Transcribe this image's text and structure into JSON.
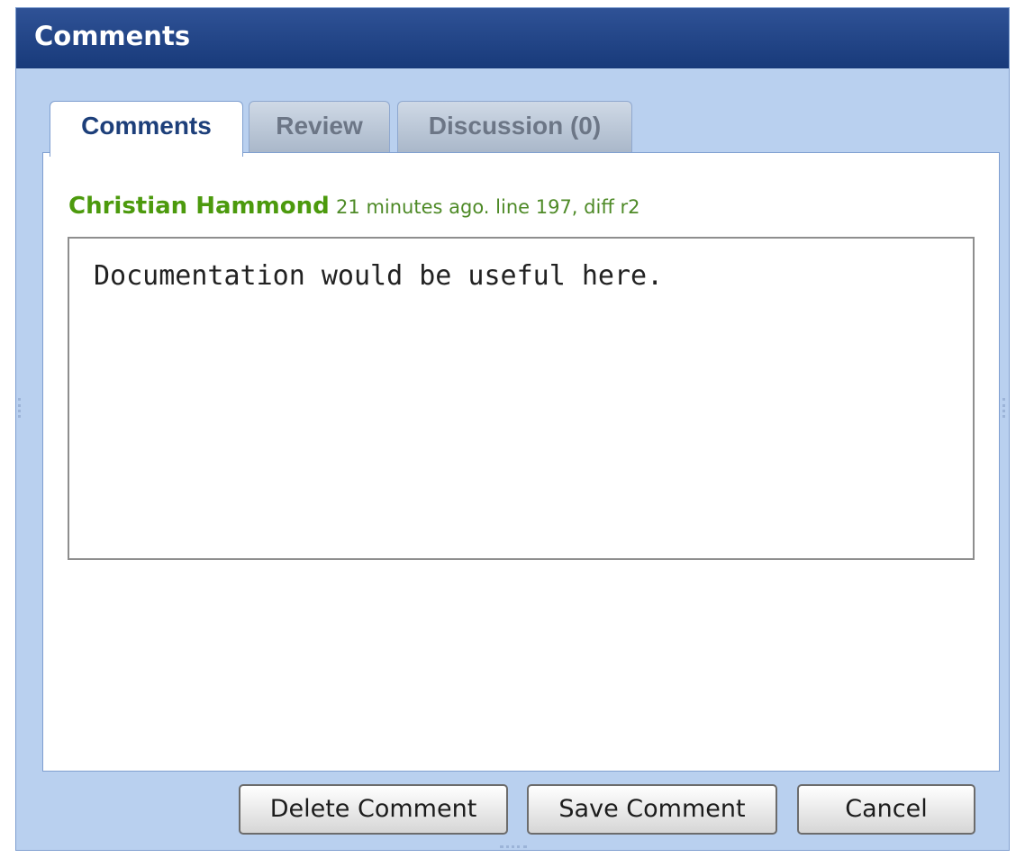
{
  "dialog": {
    "title": "Comments"
  },
  "tabs": [
    {
      "label": "Comments",
      "active": true
    },
    {
      "label": "Review",
      "active": false
    },
    {
      "label": "Discussion (0)",
      "active": false
    }
  ],
  "comment": {
    "author": "Christian Hammond",
    "meta": "21 minutes ago. line 197, diff r2",
    "text": "Documentation would be useful here."
  },
  "buttons": {
    "delete_label": "Delete Comment",
    "save_label": "Save Comment",
    "cancel_label": "Cancel"
  },
  "colors": {
    "titlebar": "#1f4185",
    "dialog_bg": "#b9d0ef",
    "author": "#4c9a0d",
    "meta": "#4e8a27"
  }
}
